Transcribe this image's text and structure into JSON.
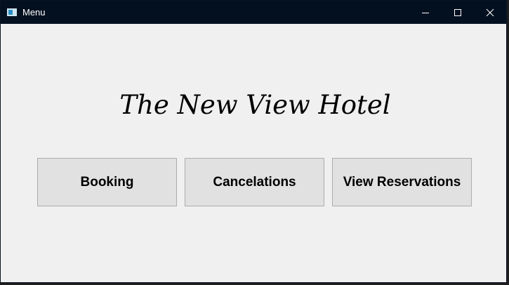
{
  "window": {
    "title": "Menu",
    "icon": "app-window-icon",
    "controls": [
      "minimize-icon",
      "maximize-icon",
      "close-icon"
    ]
  },
  "main": {
    "heading": "The New View Hotel",
    "buttons": {
      "booking": "Booking",
      "cancelations": "Cancelations",
      "view_reservations": "View Reservations"
    }
  },
  "colors": {
    "titlebar": "#03101f",
    "background": "#f0f0f0",
    "button_face": "#e1e1e1",
    "button_border": "#adadad"
  }
}
